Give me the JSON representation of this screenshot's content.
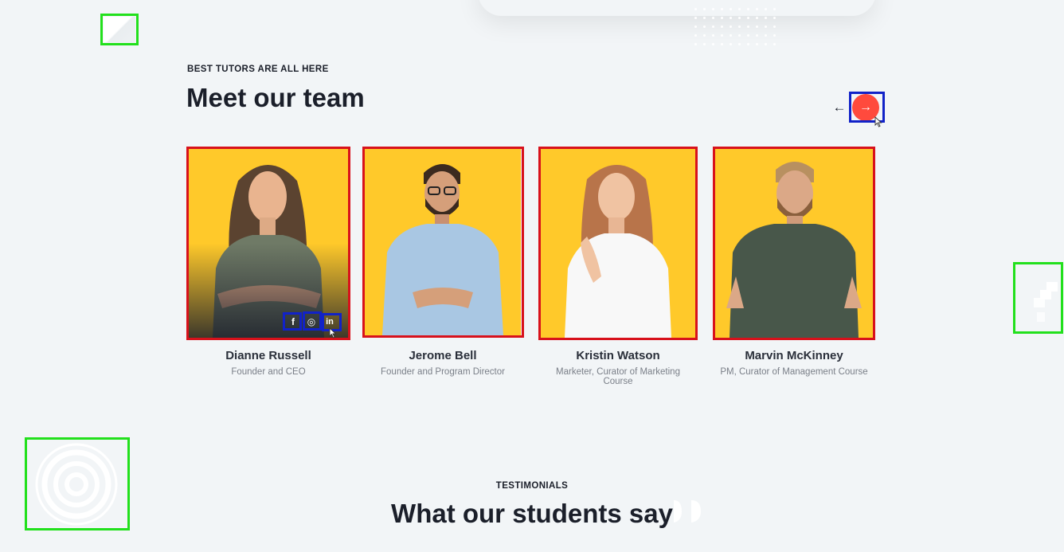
{
  "team_section": {
    "eyebrow": "BEST TUTORS ARE ALL HERE",
    "title": "Meet our team",
    "prev_arrow": "←",
    "next_arrow": "→"
  },
  "members": [
    {
      "name": "Dianne Russell",
      "role": "Founder and CEO",
      "photo_tone": "#ffc92a"
    },
    {
      "name": "Jerome Bell",
      "role": "Founder and Program Director",
      "photo_tone": "#ffc92a"
    },
    {
      "name": "Kristin Watson",
      "role": "Marketer, Curator of Marketing Course",
      "photo_tone": "#ffc92a"
    },
    {
      "name": "Marvin McKinney",
      "role": "PM, Curator of Management Course",
      "photo_tone": "#ffc92a"
    }
  ],
  "social_icons": [
    {
      "icon": "facebook-icon",
      "glyph": "f"
    },
    {
      "icon": "instagram-icon",
      "glyph": "◎"
    },
    {
      "icon": "linkedin-icon",
      "glyph": "in"
    }
  ],
  "testimonials_section": {
    "eyebrow": "TESTIMONIALS",
    "title": "What our students say"
  },
  "colors": {
    "background": "#f2f5f7",
    "accent": "#ff4a3d",
    "photo_bg": "#ffc92a",
    "text_dark": "#1b1f2a",
    "text_muted": "#7a7f88"
  }
}
